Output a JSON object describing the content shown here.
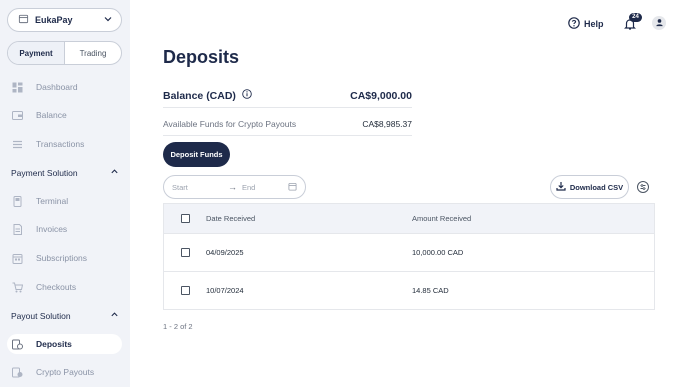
{
  "workspace": {
    "name": "EukaPay"
  },
  "mode_tabs": [
    {
      "label": "Payment",
      "active": true
    },
    {
      "label": "Trading",
      "active": false
    }
  ],
  "nav": {
    "dashboard": "Dashboard",
    "balance": "Balance",
    "transactions": "Transactions",
    "payment_solution": "Payment Solution",
    "terminal": "Terminal",
    "invoices": "Invoices",
    "subscriptions": "Subscriptions",
    "checkouts": "Checkouts",
    "payout_solution": "Payout Solution",
    "deposits": "Deposits",
    "crypto_payouts": "Crypto Payouts"
  },
  "topbar": {
    "help": "Help",
    "notification_count": "24"
  },
  "page": {
    "title": "Deposits"
  },
  "balance": {
    "label": "Balance (CAD)",
    "value": "CA$9,000.00",
    "available_label": "Available Funds for Crypto Payouts",
    "available_value": "CA$8,985.37"
  },
  "actions": {
    "deposit": "Deposit Funds",
    "download_csv": "Download CSV"
  },
  "filter": {
    "start_placeholder": "Start",
    "end_placeholder": "End",
    "arrow": "→"
  },
  "table": {
    "columns": [
      "Date Received",
      "Amount Received"
    ],
    "rows": [
      {
        "date": "04/09/2025",
        "amount": "10,000.00 CAD"
      },
      {
        "date": "10/07/2024",
        "amount": "14.85 CAD"
      }
    ]
  },
  "pagination": {
    "text": "1 - 2 of 2"
  },
  "colors": {
    "brand": "#1e2a4a",
    "sidebar_bg": "#f1f3f8"
  }
}
